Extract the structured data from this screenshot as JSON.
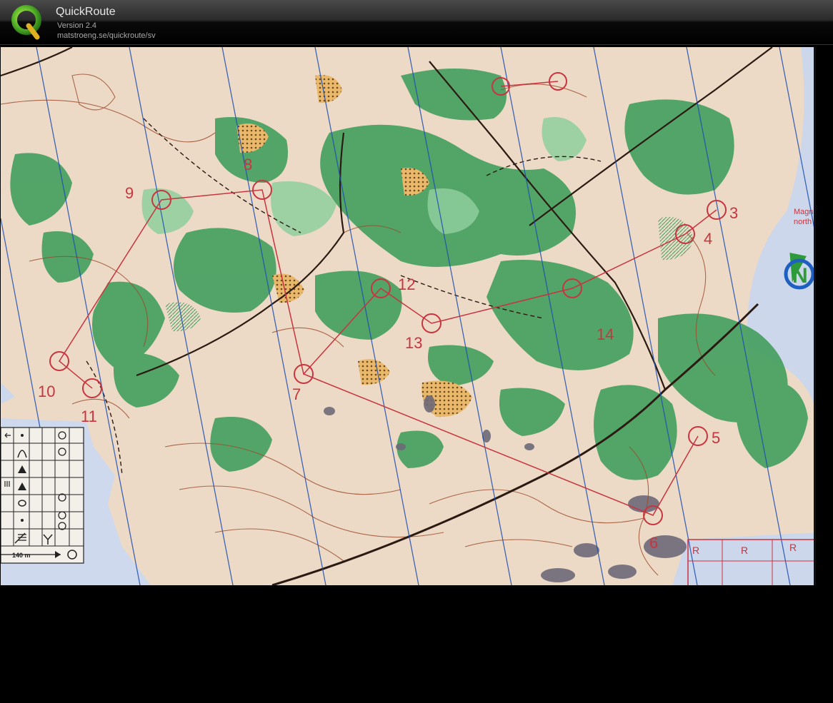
{
  "header": {
    "title": "QuickRoute",
    "version": "Version 2.4",
    "url": "matstroeng.se/quickroute/sv",
    "logo_letter": "Q"
  },
  "map": {
    "controls": [
      {
        "label": "3"
      },
      {
        "label": "4"
      },
      {
        "label": "5"
      },
      {
        "label": "6"
      },
      {
        "label": "7"
      },
      {
        "label": "8"
      },
      {
        "label": "9"
      },
      {
        "label": "10"
      },
      {
        "label": "11"
      },
      {
        "label": "12"
      },
      {
        "label": "13"
      },
      {
        "label": "14"
      }
    ],
    "north_label_1": "Magn",
    "north_label_2": "north",
    "north_letter": "N",
    "scale_label": "140 m",
    "restricted_label": "R",
    "colors": {
      "course": "#c8343f",
      "meridian": "#1f4fb0",
      "forest": "#3f9a5c",
      "open": "#eed9c2",
      "contour": "#9a4a2a"
    }
  }
}
